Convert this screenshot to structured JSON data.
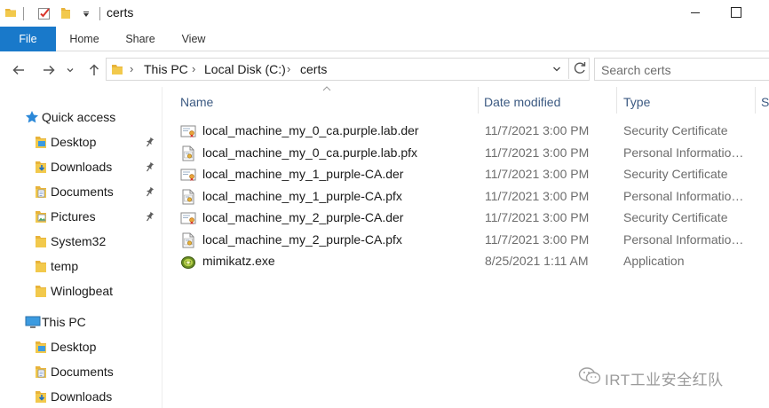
{
  "window": {
    "title": "certs"
  },
  "ribbon": {
    "tabs": [
      {
        "label": "File"
      },
      {
        "label": "Home"
      },
      {
        "label": "Share"
      },
      {
        "label": "View"
      }
    ]
  },
  "address": {
    "crumbs": [
      {
        "label": "This PC"
      },
      {
        "label": "Local Disk (C:)"
      },
      {
        "label": "certs"
      }
    ]
  },
  "search": {
    "placeholder": "Search certs"
  },
  "nav": {
    "quick_access": "Quick access",
    "quick_items": [
      {
        "label": "Desktop",
        "icon": "desktop-folder-icon",
        "pinned": true
      },
      {
        "label": "Downloads",
        "icon": "downloads-folder-icon",
        "pinned": true
      },
      {
        "label": "Documents",
        "icon": "documents-folder-icon",
        "pinned": true
      },
      {
        "label": "Pictures",
        "icon": "pictures-folder-icon",
        "pinned": true
      },
      {
        "label": "System32",
        "icon": "folder-icon",
        "pinned": false
      },
      {
        "label": "temp",
        "icon": "folder-icon",
        "pinned": false
      },
      {
        "label": "Winlogbeat",
        "icon": "folder-icon",
        "pinned": false
      }
    ],
    "this_pc": "This PC",
    "pc_items": [
      {
        "label": "Desktop",
        "icon": "desktop-folder-icon"
      },
      {
        "label": "Documents",
        "icon": "documents-folder-icon"
      },
      {
        "label": "Downloads",
        "icon": "downloads-folder-icon"
      }
    ]
  },
  "columns": {
    "name": "Name",
    "date": "Date modified",
    "type": "Type",
    "size": "S"
  },
  "files": [
    {
      "name": "local_machine_my_0_ca.purple.lab.der",
      "date": "11/7/2021 3:00 PM",
      "type": "Security Certificate",
      "icon": "certificate-icon"
    },
    {
      "name": "local_machine_my_0_ca.purple.lab.pfx",
      "date": "11/7/2021 3:00 PM",
      "type": "Personal Information...",
      "icon": "pfx-icon"
    },
    {
      "name": "local_machine_my_1_purple-CA.der",
      "date": "11/7/2021 3:00 PM",
      "type": "Security Certificate",
      "icon": "certificate-icon"
    },
    {
      "name": "local_machine_my_1_purple-CA.pfx",
      "date": "11/7/2021 3:00 PM",
      "type": "Personal Information...",
      "icon": "pfx-icon"
    },
    {
      "name": "local_machine_my_2_purple-CA.der",
      "date": "11/7/2021 3:00 PM",
      "type": "Security Certificate",
      "icon": "certificate-icon"
    },
    {
      "name": "local_machine_my_2_purple-CA.pfx",
      "date": "11/7/2021 3:00 PM",
      "type": "Personal Information...",
      "icon": "pfx-icon"
    },
    {
      "name": "mimikatz.exe",
      "date": "8/25/2021 1:11 AM",
      "type": "Application",
      "icon": "kiwi-app-icon"
    }
  ],
  "watermark": {
    "text": "IRT工业安全红队"
  },
  "colors": {
    "accent": "#1979ca",
    "folder": "#e8b33a",
    "header_text": "#3c5a82",
    "meta_text": "#6d6d6d"
  }
}
